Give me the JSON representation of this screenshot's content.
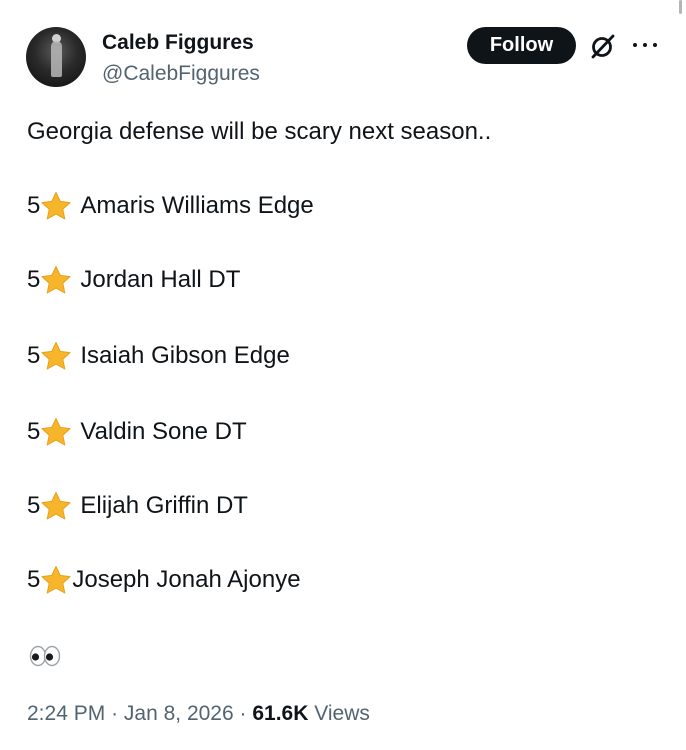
{
  "author": {
    "display_name": "Caleb Figgures",
    "handle": "@CalebFiggures"
  },
  "actions": {
    "follow_label": "Follow",
    "grok_icon": "grok-slash-circle-icon",
    "more_icon": "more-dots-icon"
  },
  "tweet": {
    "text": "Georgia defense will be scary next season..",
    "players": [
      {
        "stars": "5",
        "name": "Amaris Williams Edge"
      },
      {
        "stars": "5",
        "name": "Jordan Hall DT"
      },
      {
        "stars": "5",
        "name": "Isaiah Gibson Edge"
      },
      {
        "stars": "5",
        "name": "Valdin Sone DT"
      },
      {
        "stars": "5",
        "name": "Elijah Griffin DT"
      },
      {
        "stars": "5",
        "name": "Joseph Jonah Ajonye"
      }
    ],
    "star_icon": "star-emoji-icon",
    "trailing_emoji": "eyes-emoji-icon"
  },
  "meta": {
    "time": "2:24 PM",
    "separator": "·",
    "date": "Jan 8, 2026",
    "views_count": "61.6K",
    "views_label": "Views"
  },
  "colors": {
    "text_primary": "#0f1419",
    "text_secondary": "#536471",
    "follow_bg": "#0f1419",
    "star": "#f7b52c"
  }
}
